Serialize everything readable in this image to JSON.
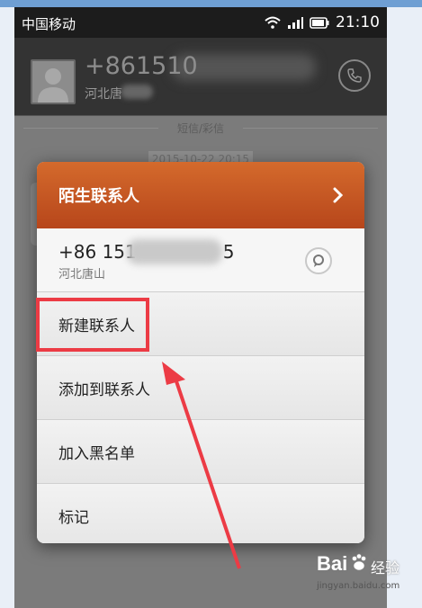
{
  "status_bar": {
    "carrier": "中国移动",
    "time": "21:10"
  },
  "call_header": {
    "number_partial": "+861510",
    "location_partial": "河北唐"
  },
  "conversation": {
    "section_label": "短信/彩信",
    "timestamp": "2015-10-22 20:15"
  },
  "dialog": {
    "title": "陌生联系人",
    "contact_number": "+86 151",
    "contact_number_tail": "5",
    "contact_location": "河北唐山",
    "menu": [
      {
        "label": "新建联系人"
      },
      {
        "label": "添加到联系人"
      },
      {
        "label": "加入黑名单"
      },
      {
        "label": "标记"
      }
    ]
  },
  "watermark": {
    "logo_text": "Bai",
    "logo_suffix": "经验",
    "url": "jingyan.baidu.com"
  },
  "colors": {
    "dialog_header": "#c4521f",
    "highlight": "#ec3b45",
    "page_bg": "#e9eff7"
  }
}
